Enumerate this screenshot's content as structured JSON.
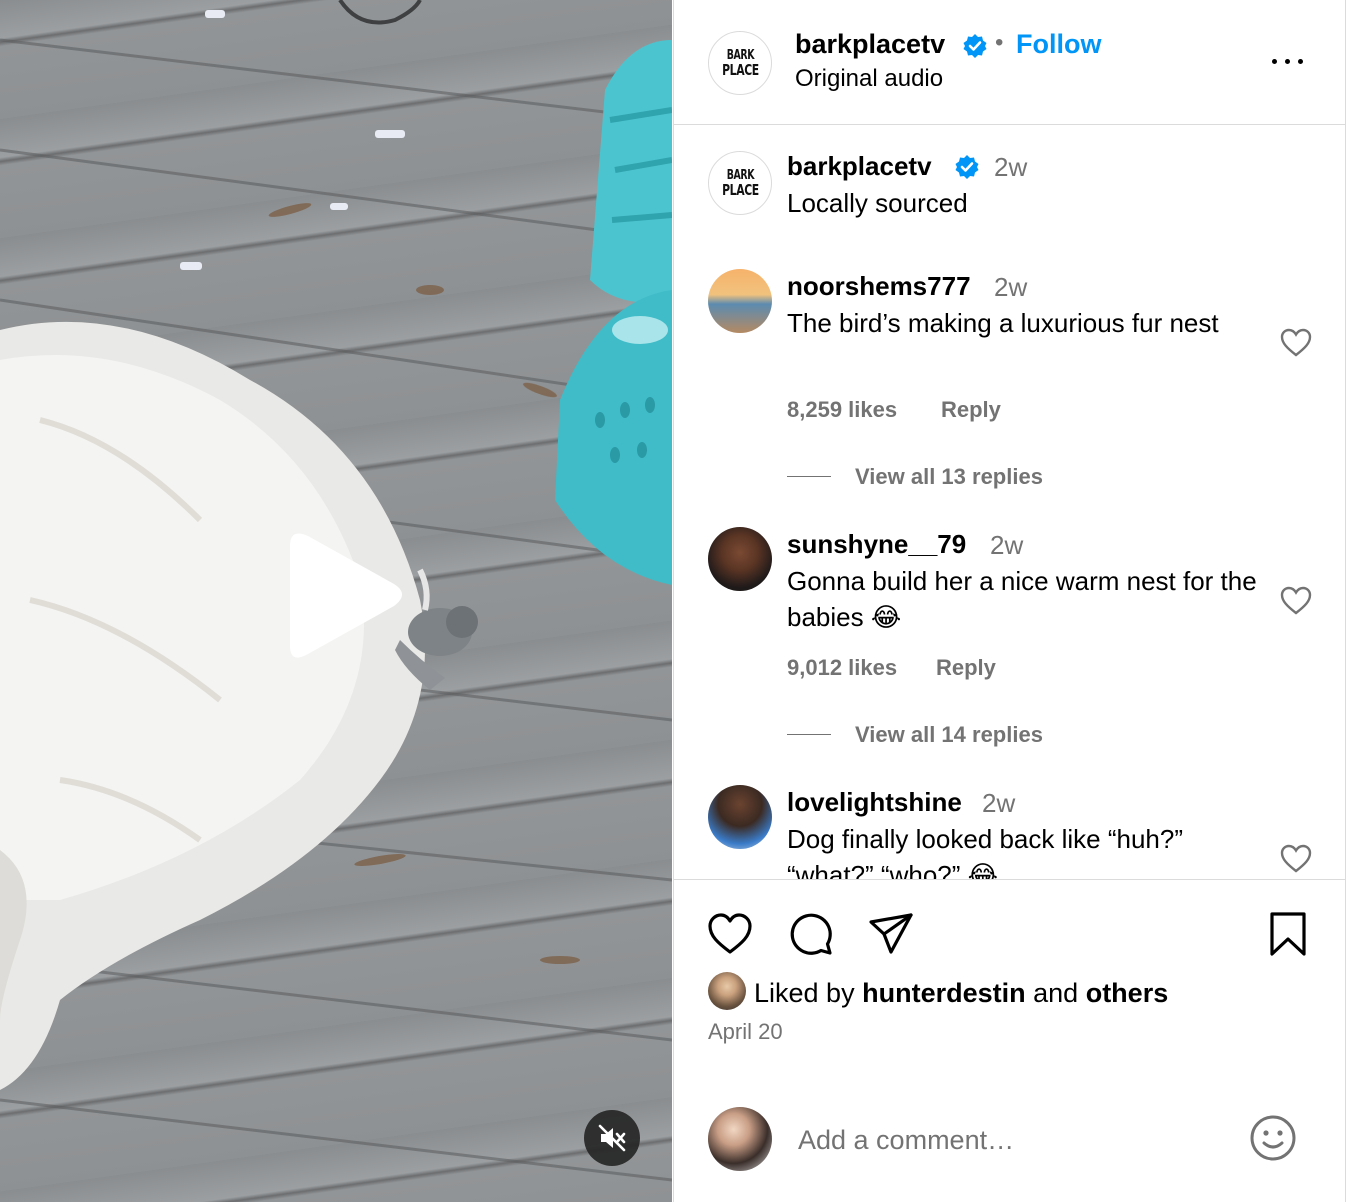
{
  "post": {
    "username": "barkplacetv",
    "verified": true,
    "separator": "•",
    "follow_label": "Follow",
    "audio": "Original audio",
    "logo_text_line1": "BARK",
    "logo_text_line2": "PLACE"
  },
  "caption": {
    "username": "barkplacetv",
    "time": "2w",
    "text": "Locally sourced"
  },
  "comments": [
    {
      "username": "noorshems777",
      "time": "2w",
      "text": "The bird’s making a luxurious fur nest",
      "likes": "8,259 likes",
      "reply_label": "Reply",
      "view_replies": "View all 13 replies"
    },
    {
      "username": "sunshyne__79",
      "time": "2w",
      "text": "Gonna build her a nice warm nest for the babies 😂",
      "likes": "9,012 likes",
      "reply_label": "Reply",
      "view_replies": "View all 14 replies"
    },
    {
      "username": "lovelightshine",
      "time": "2w",
      "text": "Dog finally looked back like “huh?” “what?” “who?” 😂"
    }
  ],
  "engagement": {
    "liked_by_prefix": "Liked by",
    "liked_by_user": "hunterdestin",
    "and_label": "and",
    "others_label": "others",
    "date": "April 20"
  },
  "add_comment": {
    "placeholder": "Add a comment…"
  },
  "icons": {
    "verified": "verified-badge-icon",
    "more": "more-options-icon",
    "like": "heart-icon",
    "comment": "comment-icon",
    "share": "send-icon",
    "save": "bookmark-icon",
    "emoji": "emoji-icon",
    "play": "play-icon",
    "mute": "muted-speaker-icon"
  },
  "colors": {
    "accent": "#0095f6",
    "secondary_text": "#737373",
    "border": "#dbdbdb"
  }
}
